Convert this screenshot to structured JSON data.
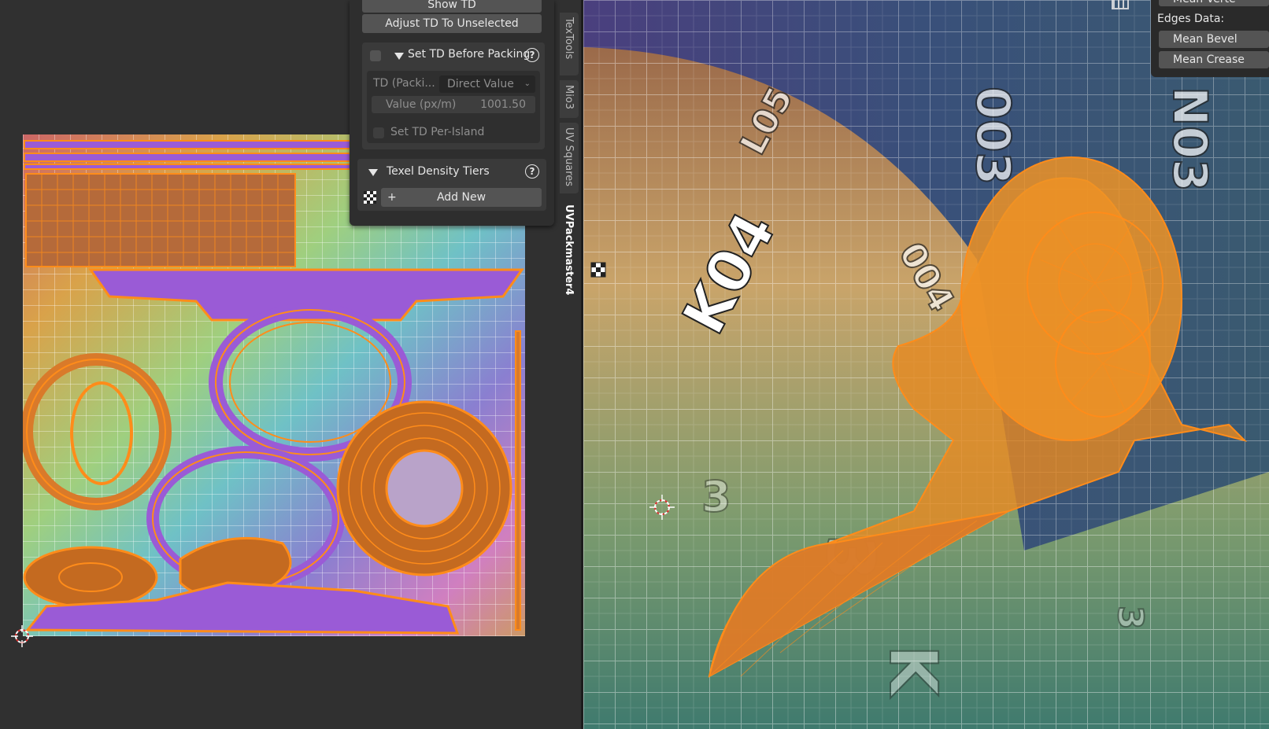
{
  "td_panel": {
    "show_td_label": "Show TD",
    "adjust_td_label": "Adjust TD To Unselected",
    "set_td_before_packing": {
      "title": "Set TD Before Packing",
      "enabled": false,
      "mode_label": "TD (Packi...",
      "mode_value": "Direct Value",
      "value_label": "Value (px/m)",
      "value": "1001.50",
      "per_island_label": "Set TD Per-Island",
      "per_island_checked": false
    },
    "texel_density_tiers": {
      "title": "Texel Density Tiers",
      "add_new_label": "Add New"
    }
  },
  "sidebar_tabs": [
    {
      "label": "TexTools",
      "active": false
    },
    {
      "label": "Mio3",
      "active": false
    },
    {
      "label": "UV Squares",
      "active": false
    },
    {
      "label": "UVPackmaster4",
      "active": true
    }
  ],
  "viewport_panel": {
    "mean_vertex_label": "Mean Verte",
    "edges_data_label": "Edges Data:",
    "mean_bevel_label": "Mean Bevel",
    "mean_crease_label": "Mean Crease"
  },
  "texture_labels": [
    "K04",
    "L05",
    "004",
    "003",
    "N03",
    "3",
    "3",
    "3",
    "K"
  ],
  "colors": {
    "selection": "#ff8c1a",
    "uv_island_fill": "#9a5bd6",
    "panel_bg": "#2e2e2e",
    "button": "#545454",
    "editor_bg": "#303030"
  },
  "icons": [
    "checker-icon",
    "plus-icon",
    "help-icon",
    "grid-icon",
    "cursor-icon",
    "collapse-triangle-icon"
  ]
}
